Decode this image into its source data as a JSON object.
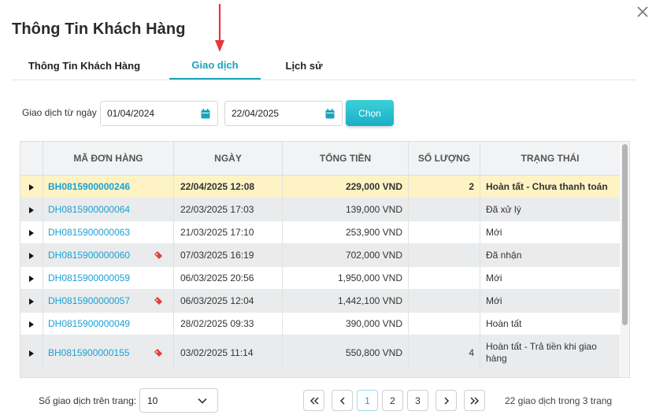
{
  "dialog": {
    "title": "Thông Tin Khách Hàng"
  },
  "tabs": [
    {
      "label": "Thông Tin Khách Hàng",
      "active": false
    },
    {
      "label": "Giao dịch",
      "active": true
    },
    {
      "label": "Lịch sử",
      "active": false
    }
  ],
  "filter": {
    "label": "Giao dịch từ ngày",
    "from_date": "01/04/2024",
    "to_date": "22/04/2025",
    "choose_label": "Chọn"
  },
  "table": {
    "headers": [
      "MÃ ĐƠN HÀNG",
      "NGÀY",
      "TỔNG TIỀN",
      "SỐ LƯỢNG",
      "TRẠNG THÁI"
    ],
    "rows": [
      {
        "code": "BH0815900000246",
        "date": "22/04/2025 12:08",
        "total": "229,000 VND",
        "qty": "2",
        "status": "Hoàn tất - Chưa thanh toán",
        "tag": false,
        "selected": true
      },
      {
        "code": "DH0815900000064",
        "date": "22/03/2025 17:03",
        "total": "139,000 VND",
        "qty": "",
        "status": "Đã xử lý",
        "tag": false,
        "selected": false
      },
      {
        "code": "DH0815900000063",
        "date": "21/03/2025 17:10",
        "total": "253,900 VND",
        "qty": "",
        "status": "Mới",
        "tag": false,
        "selected": false
      },
      {
        "code": "DH0815900000060",
        "date": "07/03/2025 16:19",
        "total": "702,000 VND",
        "qty": "",
        "status": "Đã nhận",
        "tag": true,
        "selected": false
      },
      {
        "code": "DH0815900000059",
        "date": "06/03/2025 20:56",
        "total": "1,950,000 VND",
        "qty": "",
        "status": "Mới",
        "tag": false,
        "selected": false
      },
      {
        "code": "DH0815900000057",
        "date": "06/03/2025 12:04",
        "total": "1,442,100 VND",
        "qty": "",
        "status": "Mới",
        "tag": true,
        "selected": false
      },
      {
        "code": "DH0815900000049",
        "date": "28/02/2025 09:33",
        "total": "390,000 VND",
        "qty": "",
        "status": "Hoàn tất",
        "tag": false,
        "selected": false
      },
      {
        "code": "BH0815900000155",
        "date": "03/02/2025 11:14",
        "total": "550,800 VND",
        "qty": "4",
        "status": "Hoàn tất - Trả tiền khi giao hàng",
        "tag": true,
        "selected": false
      }
    ]
  },
  "pager": {
    "label": "Số giao dịch trên trang:",
    "page_size": "10",
    "pages": [
      "1",
      "2",
      "3"
    ],
    "current_page": "1",
    "info": "22 giao dịch trong 3 trang"
  },
  "colors": {
    "accent": "#1aa3ba",
    "link": "#1a9fd8",
    "selected_row": "#fdf3c4",
    "annotation_arrow": "#e8343c"
  },
  "icons": {
    "close": "close-icon",
    "calendar": "calendar-icon",
    "expand": "expand-row-icon",
    "tag": "price-tag-icon",
    "first": "double-chevron-left-icon",
    "prev": "chevron-left-icon",
    "next": "chevron-right-icon",
    "last": "double-chevron-right-icon",
    "dropdown": "chevron-down-icon"
  }
}
